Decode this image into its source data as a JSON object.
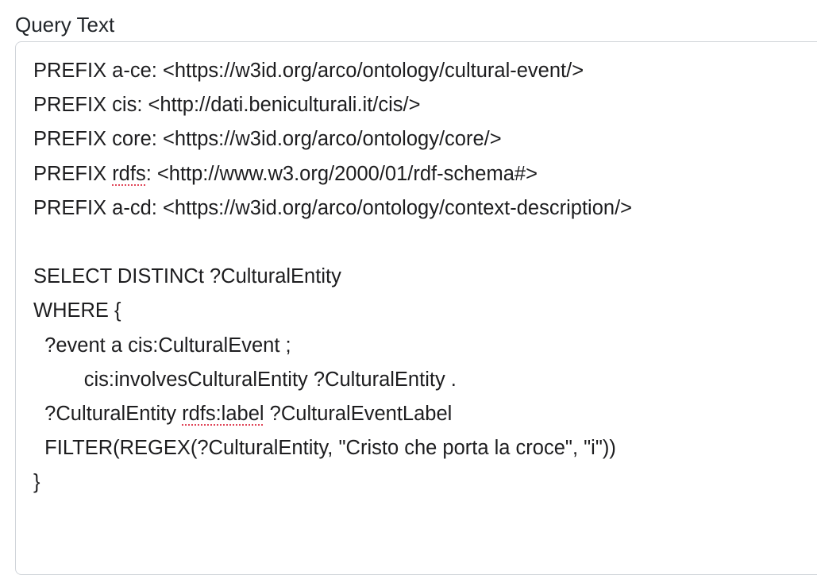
{
  "query_field": {
    "label": "Query Text",
    "lines": [
      {
        "text": "PREFIX a-ce: <https://w3id.org/arco/ontology/cultural-event/>"
      },
      {
        "text": "PREFIX cis: <http://dati.beniculturali.it/cis/>"
      },
      {
        "text": "PREFIX core: <https://w3id.org/arco/ontology/core/>"
      },
      {
        "before": "PREFIX ",
        "flagged": "rdfs",
        "after": ": <http://www.w3.org/2000/01/rdf-schema#>"
      },
      {
        "text": "PREFIX a-cd: <https://w3id.org/arco/ontology/context-description/>"
      },
      {
        "text": ""
      },
      {
        "text": "SELECT DISTINCt ?CulturalEntity"
      },
      {
        "text": "WHERE {"
      },
      {
        "text": "  ?event a cis:CulturalEvent ;"
      },
      {
        "text": "         cis:involvesCulturalEntity ?CulturalEntity ."
      },
      {
        "before": "  ?CulturalEntity ",
        "flagged": "rdfs:label",
        "after": " ?CulturalEventLabel"
      },
      {
        "text": "  FILTER(REGEX(?CulturalEntity, \"Cristo che porta la croce\", \"i\"))"
      },
      {
        "text": "}"
      }
    ]
  },
  "colors": {
    "text": "#1d1d1f",
    "border": "#d0d4d9",
    "spellcheck_underline": "#e0475a"
  }
}
